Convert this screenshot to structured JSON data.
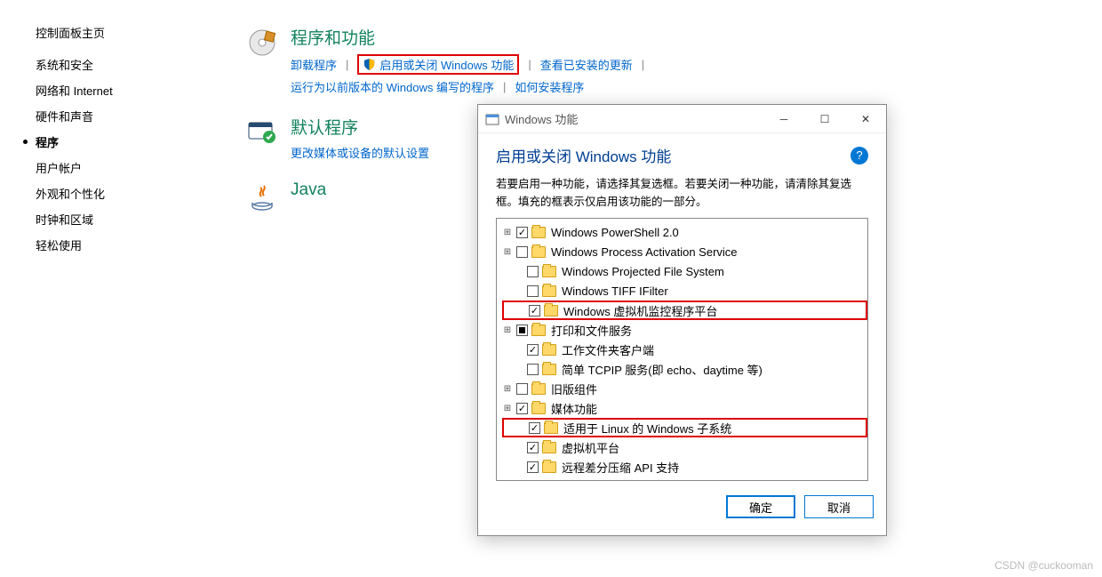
{
  "sidebar": {
    "title": "控制面板主页",
    "items": [
      {
        "label": "系统和安全"
      },
      {
        "label": "网络和 Internet"
      },
      {
        "label": "硬件和声音"
      },
      {
        "label": "程序",
        "active": true
      },
      {
        "label": "用户帐户"
      },
      {
        "label": "外观和个性化"
      },
      {
        "label": "时钟和区域"
      },
      {
        "label": "轻松使用"
      }
    ]
  },
  "main": {
    "programs": {
      "title": "程序和功能",
      "links": {
        "uninstall": "卸载程序",
        "turn_features": "启用或关闭 Windows 功能",
        "view_updates": "查看已安装的更新",
        "run_old": "运行为以前版本的 Windows 编写的程序",
        "how_install": "如何安装程序"
      }
    },
    "defaults": {
      "title": "默认程序",
      "link": "更改媒体或设备的默认设置"
    },
    "java": {
      "title": "Java"
    }
  },
  "dialog": {
    "title": "Windows 功能",
    "heading": "启用或关闭 Windows 功能",
    "desc": "若要启用一种功能，请选择其复选框。若要关闭一种功能，请清除其复选框。填充的框表示仅启用该功能的一部分。",
    "buttons": {
      "ok": "确定",
      "cancel": "取消"
    },
    "features": [
      {
        "label": "Windows PowerShell 2.0",
        "expand": "+",
        "state": "checked",
        "indent": 0
      },
      {
        "label": "Windows Process Activation Service",
        "expand": "+",
        "state": "unchecked",
        "indent": 0
      },
      {
        "label": "Windows Projected File System",
        "expand": "",
        "state": "unchecked",
        "indent": 1
      },
      {
        "label": "Windows TIFF IFilter",
        "expand": "",
        "state": "unchecked",
        "indent": 1
      },
      {
        "label": "Windows 虚拟机监控程序平台",
        "expand": "",
        "state": "checked",
        "indent": 1,
        "highlight": true
      },
      {
        "label": "打印和文件服务",
        "expand": "+",
        "state": "filled",
        "indent": 0
      },
      {
        "label": "工作文件夹客户端",
        "expand": "",
        "state": "checked",
        "indent": 1
      },
      {
        "label": "简单 TCPIP 服务(即 echo、daytime 等)",
        "expand": "",
        "state": "unchecked",
        "indent": 1
      },
      {
        "label": "旧版组件",
        "expand": "+",
        "state": "unchecked",
        "indent": 0
      },
      {
        "label": "媒体功能",
        "expand": "+",
        "state": "checked",
        "indent": 0
      },
      {
        "label": "适用于 Linux 的 Windows 子系统",
        "expand": "",
        "state": "checked",
        "indent": 1,
        "highlight": true
      },
      {
        "label": "虚拟机平台",
        "expand": "",
        "state": "checked",
        "indent": 1
      },
      {
        "label": "远程差分压缩 API 支持",
        "expand": "",
        "state": "checked",
        "indent": 1
      }
    ]
  },
  "watermark": "CSDN @cuckooman"
}
